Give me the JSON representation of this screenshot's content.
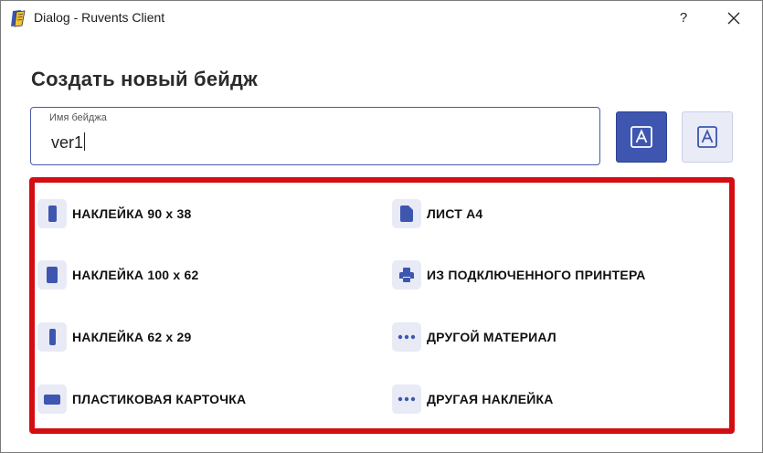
{
  "window": {
    "title": "Dialog - Ruvents Client",
    "help_label": "?"
  },
  "dialog": {
    "heading": "Создать новый бейдж",
    "name_field": {
      "label": "Имя бейджа",
      "value": "ver1"
    }
  },
  "options": {
    "left": [
      {
        "label": "НАКЛЕЙКА 90 x 38",
        "icon": "label-portrait-icon"
      },
      {
        "label": "НАКЛЕЙКА 100 x 62",
        "icon": "label-portrait-large-icon"
      },
      {
        "label": "НАКЛЕЙКА 62 x 29",
        "icon": "label-narrow-icon"
      },
      {
        "label": "ПЛАСТИКОВАЯ КАРТОЧКА",
        "icon": "card-landscape-icon"
      }
    ],
    "right": [
      {
        "label": "ЛИСТ A4",
        "icon": "document-icon"
      },
      {
        "label": "ИЗ ПОДКЛЮЧЕННОГО ПРИНТЕРА",
        "icon": "printer-icon"
      },
      {
        "label": "ДРУГОЙ МАТЕРИАЛ",
        "icon": "more-dots-icon"
      },
      {
        "label": "ДРУГАЯ НАКЛЕЙКА",
        "icon": "more-dots-icon"
      }
    ]
  },
  "colors": {
    "accent": "#3e56b0",
    "icon_bg": "#e8ebf5",
    "highlight_frame": "#d40d12"
  }
}
